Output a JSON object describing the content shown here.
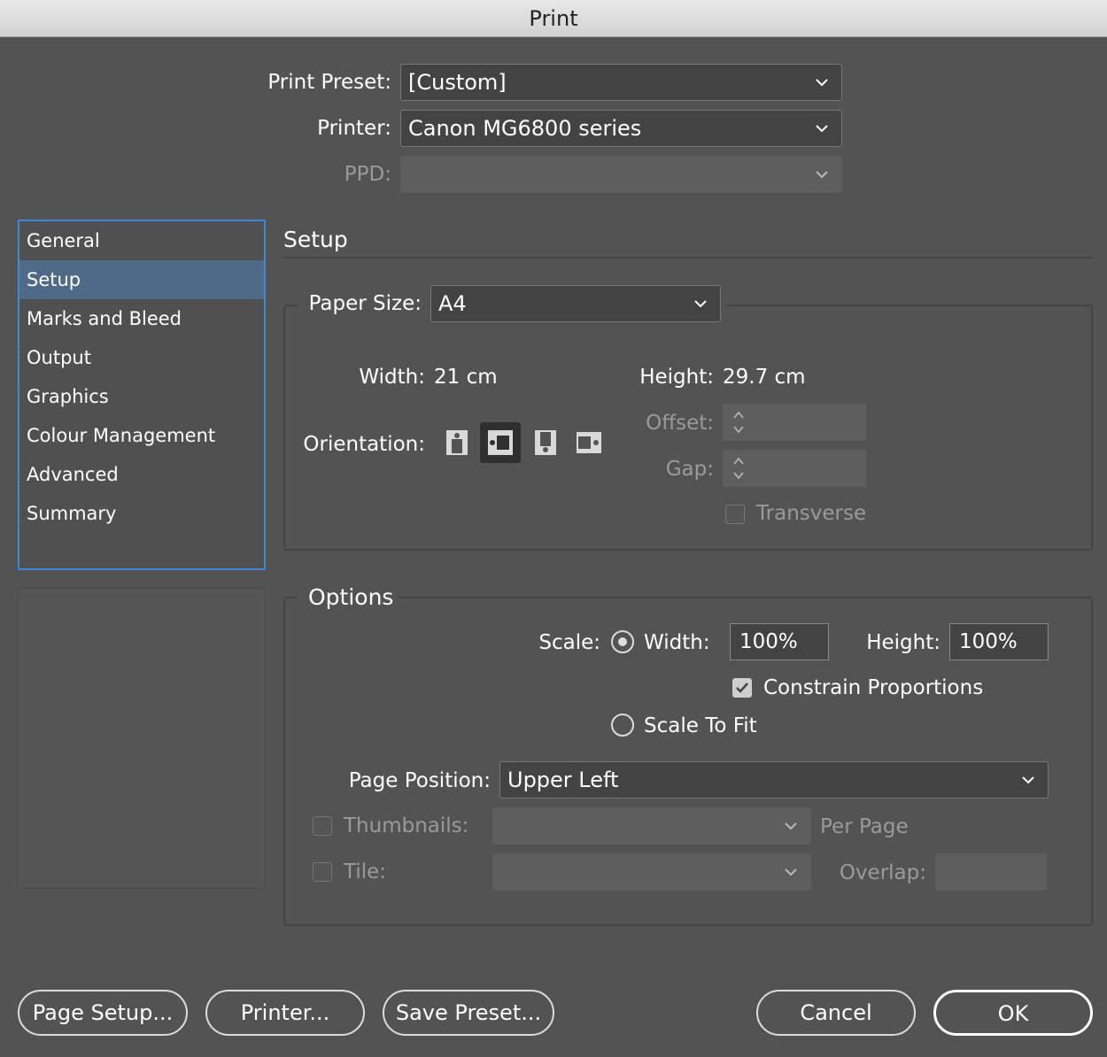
{
  "window": {
    "title": "Print"
  },
  "top": {
    "print_preset_label": "Print Preset:",
    "print_preset_value": "[Custom]",
    "printer_label": "Printer:",
    "printer_value": "Canon MG6800 series",
    "ppd_label": "PPD:",
    "ppd_value": ""
  },
  "sidebar": {
    "items": [
      {
        "label": "General"
      },
      {
        "label": "Setup"
      },
      {
        "label": "Marks and Bleed"
      },
      {
        "label": "Output"
      },
      {
        "label": "Graphics"
      },
      {
        "label": "Colour Management"
      },
      {
        "label": "Advanced"
      },
      {
        "label": "Summary"
      }
    ],
    "selected": "Setup"
  },
  "setup": {
    "title": "Setup",
    "paper_size_label": "Paper Size:",
    "paper_size_value": "A4",
    "width_label": "Width:",
    "width_value": "21 cm",
    "height_label": "Height:",
    "height_value": "29.7 cm",
    "orientation_label": "Orientation:",
    "orientations": [
      "portrait-icon",
      "landscape-icon",
      "reverse-portrait-icon",
      "reverse-landscape-icon"
    ],
    "orientation_selected": "landscape-icon",
    "offset_label": "Offset:",
    "gap_label": "Gap:",
    "transverse_label": "Transverse",
    "transverse_checked": false
  },
  "options": {
    "title": "Options",
    "scale_label": "Scale:",
    "scale_width_label": "Width:",
    "scale_width_value": "100%",
    "scale_height_label": "Height:",
    "scale_height_value": "100%",
    "constrain_label": "Constrain Proportions",
    "constrain_checked": true,
    "scale_to_fit_label": "Scale To Fit",
    "scale_mode": "width",
    "page_position_label": "Page Position:",
    "page_position_value": "Upper Left",
    "thumbnails_label": "Thumbnails:",
    "thumbnails_checked": false,
    "per_page_label": "Per Page",
    "tile_label": "Tile:",
    "tile_checked": false,
    "overlap_label": "Overlap:"
  },
  "buttons": {
    "page_setup": "Page Setup...",
    "printer": "Printer...",
    "save_preset": "Save Preset...",
    "cancel": "Cancel",
    "ok": "OK"
  },
  "colors": {
    "background": "#535353",
    "sidebar_selection": "#4f6a86",
    "focus_ring": "#3d87d6"
  }
}
